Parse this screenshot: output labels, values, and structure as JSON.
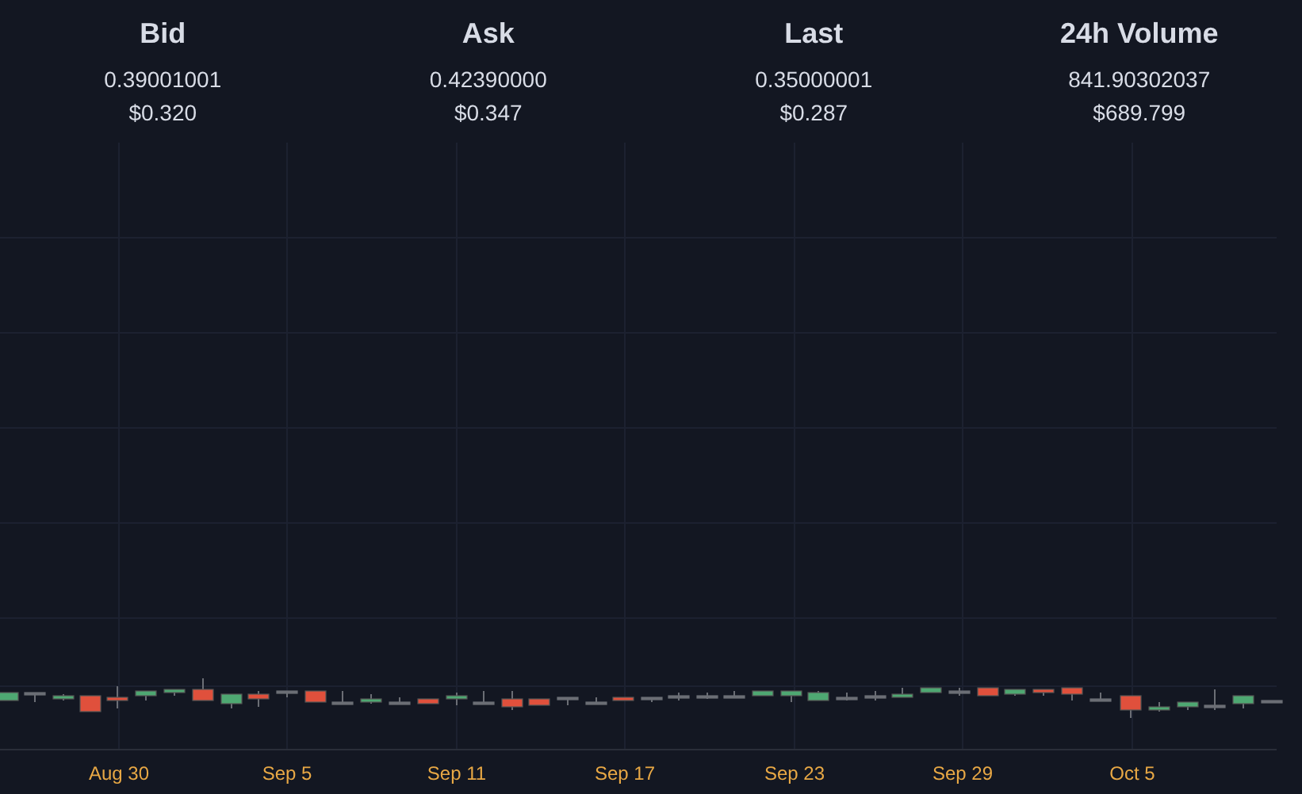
{
  "stats": [
    {
      "label": "Bid",
      "value": "0.39001001",
      "usd": "$0.320"
    },
    {
      "label": "Ask",
      "value": "0.42390000",
      "usd": "$0.347"
    },
    {
      "label": "Last",
      "value": "0.35000001",
      "usd": "$0.287"
    },
    {
      "label": "24h Volume",
      "value": "841.90302037",
      "usd": "$689.799"
    }
  ],
  "chart": {
    "x_labels": [
      "Aug 30",
      "Sep 5",
      "Sep 11",
      "Sep 17",
      "Sep 23",
      "Sep 29",
      "Oct 5"
    ]
  }
}
